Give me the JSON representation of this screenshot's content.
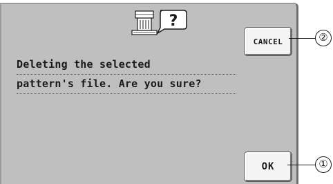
{
  "dialog": {
    "icon": "embroidery-machine-question-icon",
    "icon_glyph": "?",
    "message_lines": [
      "Deleting the selected",
      "pattern's file. Are you sure?"
    ]
  },
  "buttons": {
    "cancel_label": "CANCEL",
    "ok_label": "OK"
  },
  "callouts": {
    "cancel_number": "②",
    "ok_number": "①"
  },
  "colors": {
    "panel_background": "#bfbfbf",
    "button_face": "#f4f4f4",
    "text": "#1a1a1a"
  }
}
